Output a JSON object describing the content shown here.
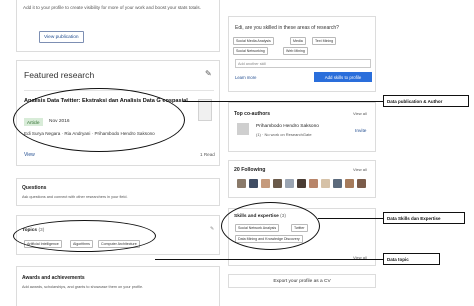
{
  "profile_prompt": {
    "text": "Add it to your profile to create visibility for more of your work and boost your stats totals.",
    "button": "View publication"
  },
  "featured": {
    "title": "Featured research",
    "pub_title": "Analisis Data Twitter: Ekstraksi dan Analisis Data G eospasial",
    "badge": "Article",
    "date": "Nov 2016",
    "authors": "Edi Surya Negara · Ria Andryani · Prihambodo Hendro Saksono",
    "view": "View",
    "reads": "1 Read"
  },
  "questions": {
    "title": "Questions",
    "text": "Ask questions and connect with other researchers in your field."
  },
  "topics": {
    "title": "Topics",
    "count": "(3)",
    "items": [
      "Artificial Intelligence",
      "Algorithms",
      "Computer Architecture"
    ]
  },
  "awards": {
    "title": "Awards and achievements",
    "text": "Add awards, scholarships, and grants to showcase them on your profile."
  },
  "skills_prompt": {
    "question": "Edi, are you skilled in these areas of research?",
    "tags": [
      "Social Media Analysis",
      "Media",
      "Text Mining",
      "Social Networking",
      "Web Mining"
    ],
    "input_placeholder": "Add another skill",
    "learn_more": "Learn more",
    "add_button": "Add skills to profile"
  },
  "coauthors": {
    "title": "Top co-authors",
    "view_all": "View all",
    "name": "Prihambodo Hendro Saksono",
    "meta": "(1) · No work on ResearchGate",
    "invite": "Invite"
  },
  "following": {
    "title": "20 Following",
    "view_all": "View all"
  },
  "skills": {
    "title": "Skills and expertise",
    "count": "(3)",
    "items": [
      "Social Network Analysis",
      "Twitter",
      "Data Mining and Knowledge Discovery"
    ],
    "view_all": "View all"
  },
  "export": {
    "label": "Export your profile as a CV"
  },
  "annotations": {
    "pub": "Data publication & Author",
    "skills": "Data Skills dan Expertise",
    "topic": "Data topic"
  },
  "colors": {
    "accent": "#2a6edb",
    "link": "#1f4b8f",
    "annotation": "#111111"
  }
}
